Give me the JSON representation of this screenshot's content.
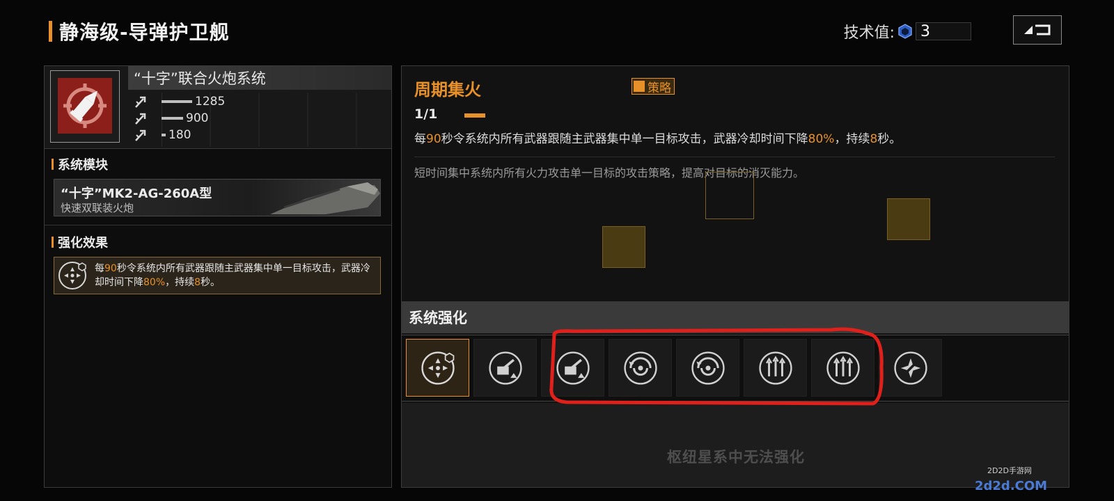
{
  "header": {
    "title": "静海级-导弹护卫舰",
    "tech_label": "技术值:",
    "tech_value": "3"
  },
  "weapon": {
    "name": "“十字”联合火炮系统",
    "stats": [
      {
        "icon": "strike-icon",
        "value": "1285"
      },
      {
        "icon": "strike-icon",
        "value": "900"
      },
      {
        "icon": "strike-icon",
        "value": "180"
      }
    ]
  },
  "module_section": {
    "title": "系统模块",
    "module_name": "“十字”MK2-AG-260A型",
    "module_desc": "快速双联装火炮"
  },
  "effect_section": {
    "title": "强化效果",
    "text_parts": [
      "每",
      "90",
      "秒令系统内所有武器跟随主武器集中单一目标攻击，武器冷却时间下降",
      "80%",
      "，持续",
      "8",
      "秒。"
    ]
  },
  "skill": {
    "name": "周期集火",
    "tag": "策略",
    "level": "1/1",
    "effect_parts": [
      "每",
      "90",
      "秒令系统内所有武器跟随主武器集中单一目标攻击，武器冷却时间下降",
      "80%",
      "，持续",
      "8",
      "秒。"
    ],
    "flavor": "短时间集中系统内所有火力攻击单一目标的攻击策略，提高对目标的消灭能力。"
  },
  "enhance": {
    "title": "系统强化",
    "slots": [
      {
        "icon": "focus-fire-icon",
        "active": true
      },
      {
        "icon": "cannon-upgrade-icon",
        "active": false
      },
      {
        "icon": "cannon-upgrade-icon",
        "active": false
      },
      {
        "icon": "radar-spin-icon",
        "active": false
      },
      {
        "icon": "radar-spin-icon",
        "active": false
      },
      {
        "icon": "triple-arrow-icon",
        "active": false
      },
      {
        "icon": "triple-arrow-icon",
        "active": false
      },
      {
        "icon": "burst-icon",
        "active": false
      }
    ],
    "locked_text": "枢纽星系中无法强化"
  },
  "watermark": {
    "site": "2D2D手游网",
    "logo": "2d2d.COM"
  },
  "colors": {
    "accent": "#e8912a",
    "annotation": "#e0201a",
    "weapon_icon_bg": "#8c1f1a"
  }
}
